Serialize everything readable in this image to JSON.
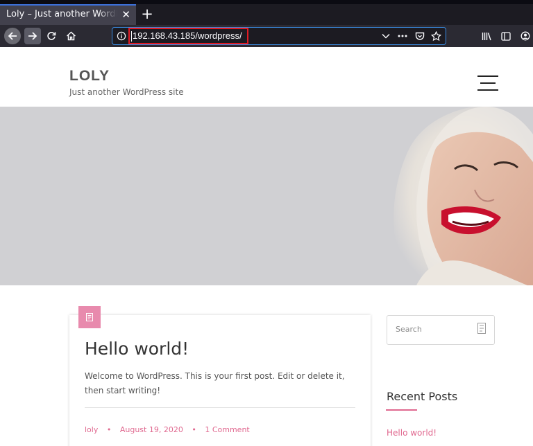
{
  "browser": {
    "tab": {
      "title": "Loly – Just another WordPress site",
      "close_glyph": "✕"
    },
    "new_tab_glyph": "+",
    "url": "192.168.43.185/wordpress/",
    "icons": [
      "back-icon",
      "forward-icon",
      "reload-icon",
      "home-icon",
      "site-info-icon",
      "dropdown-icon",
      "more-icon",
      "pocket-icon",
      "bookmark-star-icon",
      "library-icon",
      "sidebar-icon",
      "account-icon"
    ]
  },
  "site": {
    "title": "LOLY",
    "tagline": "Just another WordPress site"
  },
  "post": {
    "title": "Hello world!",
    "excerpt": "Welcome to WordPress. This is your first post. Edit or delete it, then start writing!",
    "author": "loly",
    "date": "August 19, 2020",
    "comments": "1 Comment",
    "separator": "•"
  },
  "sidebar": {
    "search_placeholder": "Search",
    "recent_posts_title": "Recent Posts",
    "recent_posts": [
      "Hello world!"
    ]
  },
  "colors": {
    "accent": "#e0688f",
    "format_badge": "#e88aad",
    "url_highlight": "#e01b24"
  }
}
